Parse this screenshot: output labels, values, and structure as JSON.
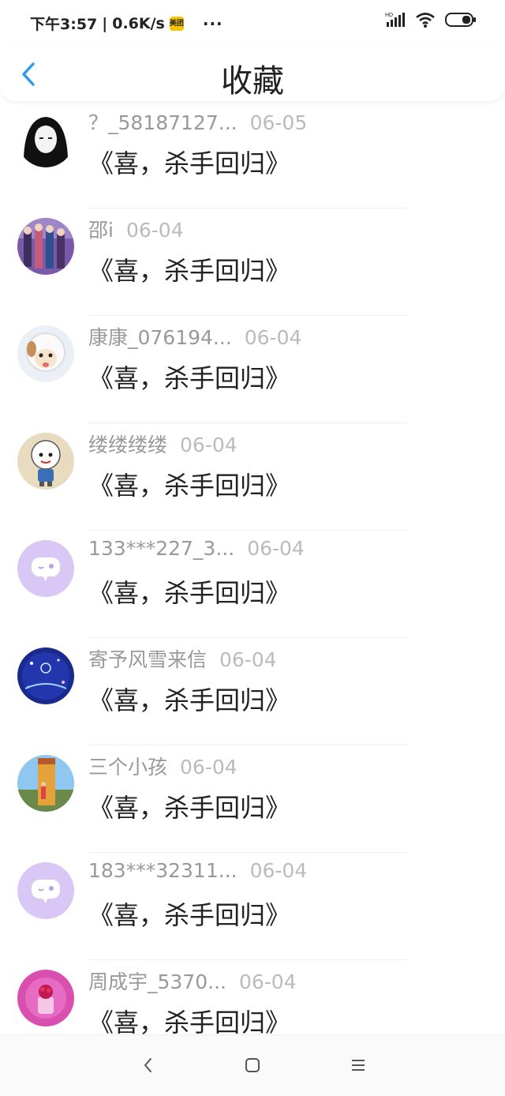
{
  "status_bar": {
    "time": "下午3:57",
    "speed": "0.6K/s",
    "app_badge": "美团",
    "dots": "···",
    "network": "HD"
  },
  "header": {
    "title": "收藏",
    "back_icon": "chevron-left-icon"
  },
  "items": [
    {
      "name": "？_58187127...",
      "date": "06-05",
      "title": "《喜，杀手回归》",
      "avatar": "avatar-dark-hair"
    },
    {
      "name": "邵i",
      "date": "06-04",
      "title": "《喜，杀手回归》",
      "avatar": "avatar-group"
    },
    {
      "name": "康康_076194...",
      "date": "06-04",
      "title": "《喜，杀手回归》",
      "avatar": "avatar-sheep"
    },
    {
      "name": "缕缕缕缕",
      "date": "06-04",
      "title": "《喜，杀手回归》",
      "avatar": "avatar-cartoon-sheep"
    },
    {
      "name": "133***227_3...",
      "date": "06-04",
      "title": "《喜，杀手回归》",
      "avatar": "avatar-default-purple"
    },
    {
      "name": "寄予风雪来信",
      "date": "06-04",
      "title": "《喜，杀手回归》",
      "avatar": "avatar-night-blue"
    },
    {
      "name": "三个小孩",
      "date": "06-04",
      "title": "《喜，杀手回归》",
      "avatar": "avatar-tower"
    },
    {
      "name": "183***32311...",
      "date": "06-04",
      "title": "《喜，杀手回归》",
      "avatar": "avatar-default-purple"
    },
    {
      "name": "周成宇_5370...",
      "date": "06-04",
      "title": "《喜，杀手回归》",
      "avatar": "avatar-pink-flower"
    }
  ],
  "nav": {
    "back": "nav-back-icon",
    "home": "nav-home-icon",
    "menu": "nav-menu-icon"
  },
  "colors": {
    "accent": "#2f9bea",
    "name_text": "#999999",
    "date_text": "#bbbbbb",
    "title_text": "#222222",
    "default_avatar": "#d9c8f5"
  }
}
